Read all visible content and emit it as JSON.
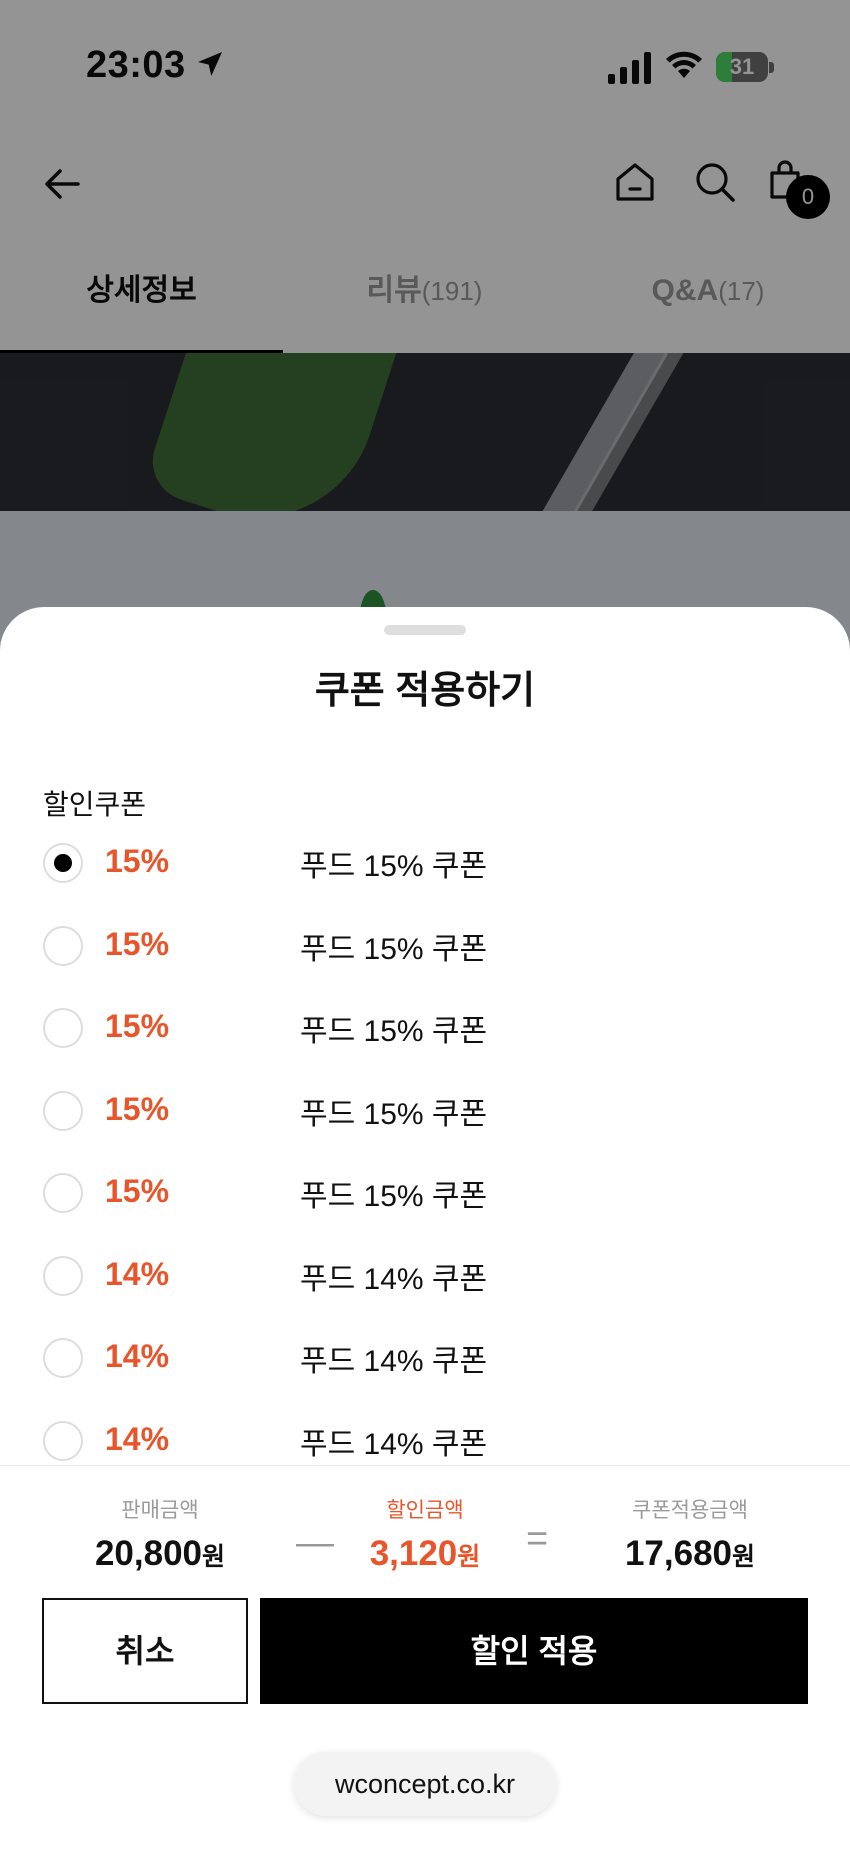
{
  "status_bar": {
    "time": "23:03",
    "battery": "31",
    "battery_level": 0.31
  },
  "header": {
    "cart_count": "0"
  },
  "tabs": [
    {
      "label": "상세정보",
      "count": "",
      "active": true
    },
    {
      "label": "리뷰",
      "count": "(191)",
      "active": false
    },
    {
      "label": "Q&A",
      "count": "(17)",
      "active": false
    }
  ],
  "sheet": {
    "title": "쿠폰 적용하기",
    "section_label": "할인쿠폰",
    "coupons": [
      {
        "rate": "15%",
        "name": "푸드 15% 쿠폰",
        "selected": true
      },
      {
        "rate": "15%",
        "name": "푸드 15% 쿠폰",
        "selected": false
      },
      {
        "rate": "15%",
        "name": "푸드 15% 쿠폰",
        "selected": false
      },
      {
        "rate": "15%",
        "name": "푸드 15% 쿠폰",
        "selected": false
      },
      {
        "rate": "15%",
        "name": "푸드 15% 쿠폰",
        "selected": false
      },
      {
        "rate": "14%",
        "name": "푸드 14% 쿠폰",
        "selected": false
      },
      {
        "rate": "14%",
        "name": "푸드 14% 쿠폰",
        "selected": false
      },
      {
        "rate": "14%",
        "name": "푸드 14% 쿠폰",
        "selected": false
      }
    ],
    "summary": {
      "sale_label": "판매금액",
      "sale_value": "20,800",
      "discount_label": "할인금액",
      "discount_value": "3,120",
      "final_label": "쿠폰적용금액",
      "final_value": "17,680",
      "unit": "원",
      "minus": "—",
      "equals": "="
    },
    "cancel_label": "취소",
    "apply_label": "할인 적용"
  },
  "browser": {
    "url": "wconcept.co.kr"
  },
  "colors": {
    "accent": "#e8552b",
    "primary": "#000000"
  }
}
